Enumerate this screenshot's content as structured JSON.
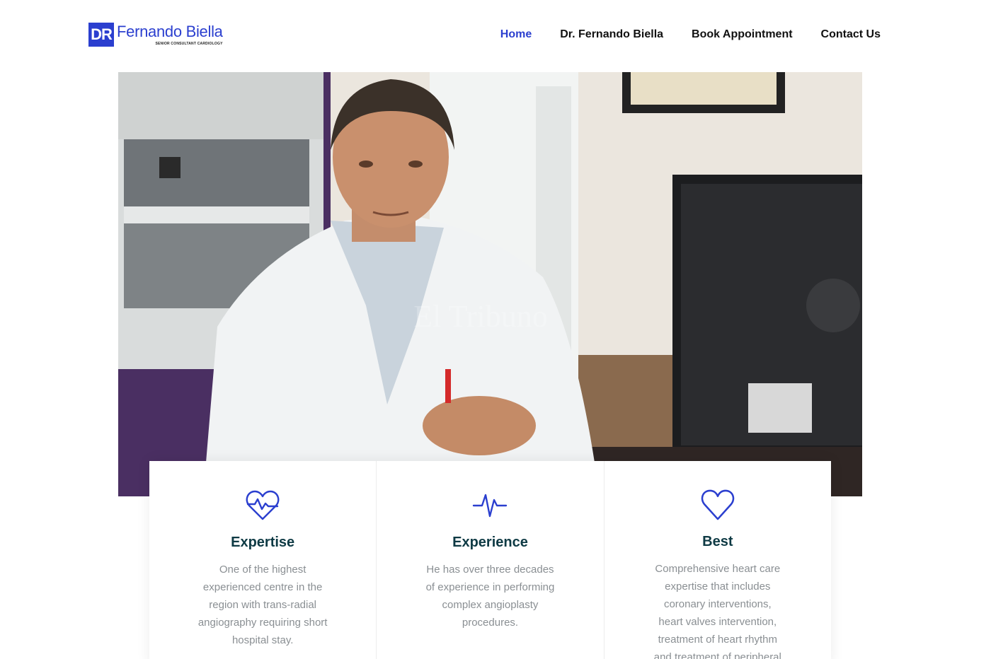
{
  "logo": {
    "badge": "DR",
    "name": "Fernando Biella",
    "subtitle": "SENIOR CONSULTANT CARDIOLOGY"
  },
  "nav": {
    "items": [
      {
        "label": "Home",
        "active": true
      },
      {
        "label": "Dr. Fernando Biella",
        "active": false
      },
      {
        "label": "Book Appointment",
        "active": false
      },
      {
        "label": "Contact Us",
        "active": false
      }
    ]
  },
  "hero": {
    "watermark": "El Tribuno"
  },
  "features": [
    {
      "icon": "heart-pulse-icon",
      "title": "Expertise",
      "text": "One of the highest experienced centre in the region with trans-radial angiography requiring short hospital stay."
    },
    {
      "icon": "heartbeat-line-icon",
      "title": "Experience",
      "text": "He has over three decades of experience in performing complex angioplasty procedures."
    },
    {
      "icon": "heart-outline-icon",
      "title": "Best",
      "text": "Comprehensive heart care expertise that includes coronary interventions, heart valves intervention, treatment of heart rhythm and treatment of peripheral"
    }
  ],
  "colors": {
    "accent": "#2b3fcf",
    "title": "#0e3a44",
    "body_text": "#8a8f93"
  }
}
